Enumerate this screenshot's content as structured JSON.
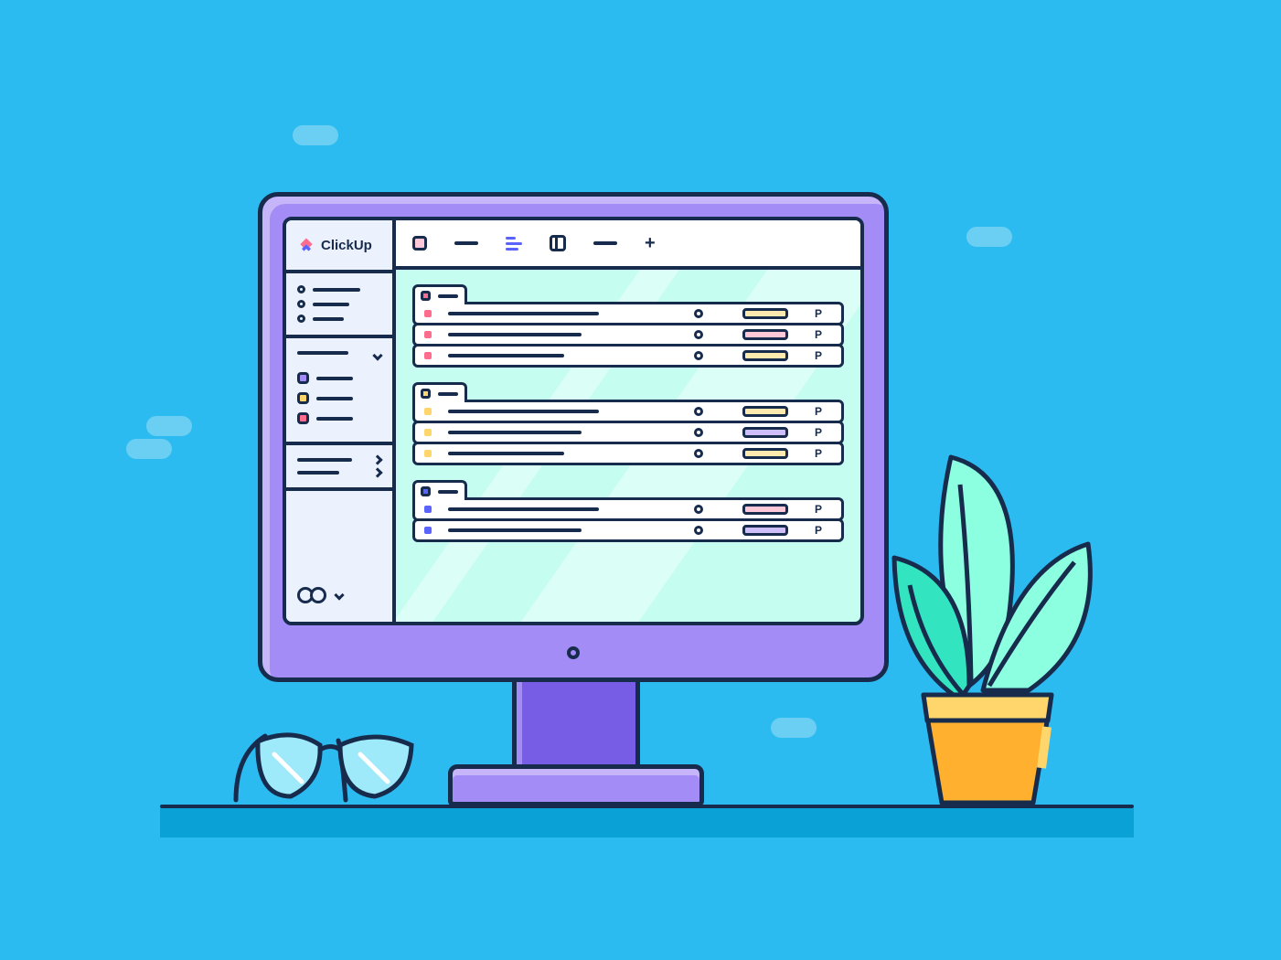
{
  "app": {
    "name": "ClickUp"
  },
  "colors": {
    "pink": "#FE6D8E",
    "yellow": "#FFD66B",
    "purple": "#A38CF5",
    "blueAccent": "#5B63FE",
    "navy": "#172B4D",
    "pinkSoft": "#FEC8D8",
    "yellowSoft": "#FEE9AF",
    "purpleSoft": "#CDBEFA"
  },
  "sidebar": {
    "nav": [
      "",
      "",
      ""
    ],
    "spaces": [
      {
        "color": "#A38CF5"
      },
      {
        "color": "#FFD66B"
      },
      {
        "color": "#FE6D8E"
      }
    ]
  },
  "topbar": {
    "views": [
      "list",
      "dash",
      "timeline",
      "board",
      "dash2",
      "add"
    ]
  },
  "groups": [
    {
      "header_color": "#FE6D8E",
      "tasks": [
        {
          "dot": "#FE6D8E",
          "tag": "#FEE9AF",
          "flag": "P"
        },
        {
          "dot": "#FE6D8E",
          "tag": "#FEC8D8",
          "flag": "P"
        },
        {
          "dot": "#FE6D8E",
          "tag": "#FEE9AF",
          "flag": "P"
        }
      ]
    },
    {
      "header_color": "#FFD66B",
      "tasks": [
        {
          "dot": "#FFD66B",
          "tag": "#FEE9AF",
          "flag": "P"
        },
        {
          "dot": "#FFD66B",
          "tag": "#CDBEFA",
          "flag": "P"
        },
        {
          "dot": "#FFD66B",
          "tag": "#FEE9AF",
          "flag": "P"
        }
      ]
    },
    {
      "header_color": "#5B63FE",
      "tasks": [
        {
          "dot": "#5B63FE",
          "tag": "#FEC8D8",
          "flag": "P"
        },
        {
          "dot": "#5B63FE",
          "tag": "#CDBEFA",
          "flag": "P"
        }
      ]
    }
  ]
}
